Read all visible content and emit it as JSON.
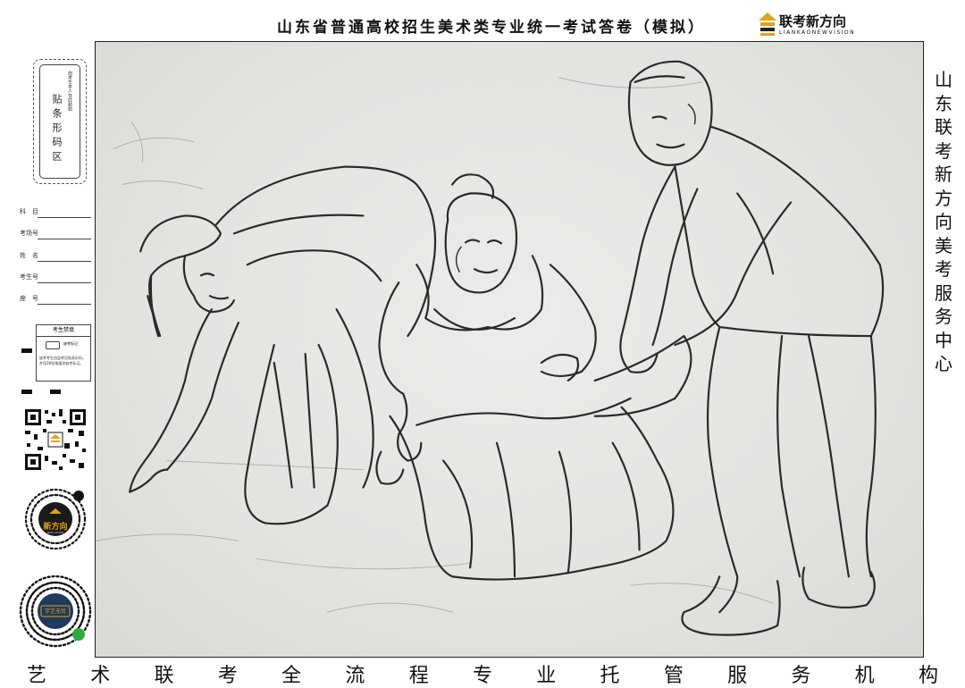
{
  "header": {
    "title": "山东省普通高校招生美术类专业统一考试答卷（模拟）",
    "logo_text": "联考新方向",
    "logo_sub": "LIANKAONEWVISION"
  },
  "sidebar": {
    "barcode_label": "贴条形码区",
    "barcode_small": "由考生本人在此粘贴",
    "fields": [
      "科　目",
      "考场号",
      "姓　名",
      "考生号",
      "座　号"
    ],
    "notice_title": "考生禁填",
    "notice_mark_label": "缺考标记",
    "notice_body": "缺考考生由监考员贴条形码，并用2B铅笔填涂缺考标记。",
    "mini_code_1": "新方向",
    "mini_code_1_sub": "NEW VISION",
    "mini_code_2": "学艺无忧"
  },
  "right_column": [
    "山",
    "东",
    "联",
    "考",
    "新",
    "方",
    "向",
    "美",
    "考",
    "服",
    "务",
    "中",
    "心"
  ],
  "bottom_row": [
    "艺",
    "术",
    "联",
    "考",
    "全",
    "流",
    "程",
    "专",
    "业",
    "托",
    "管",
    "服",
    "务",
    "机",
    "构"
  ],
  "colors": {
    "ink": "#111111",
    "paper": "#e6e6e3",
    "pencil": "#2a2a2a"
  }
}
